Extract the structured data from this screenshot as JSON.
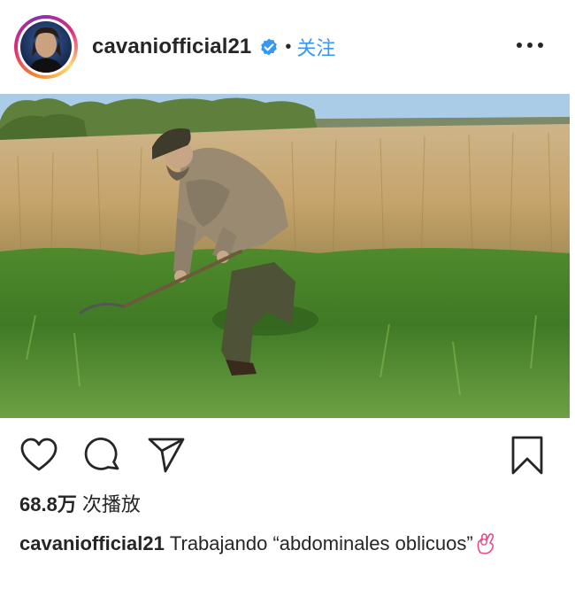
{
  "post_header": {
    "username": "cavaniofficial21",
    "separator": "•",
    "follow_label": "关注"
  },
  "stats": {
    "view_count": "68.8万",
    "view_unit": "次播放"
  },
  "caption": {
    "username": "cavaniofficial21",
    "text": "Trabajando “abdominales oblicuos”"
  },
  "colors": {
    "follow": "#3897f0",
    "verified": "#3897f0",
    "text": "#262626"
  },
  "icons": [
    "verified-badge-icon",
    "more-options-icon",
    "heart-icon",
    "comment-icon",
    "share-icon",
    "bookmark-icon",
    "ok-hand-emoji-icon"
  ]
}
